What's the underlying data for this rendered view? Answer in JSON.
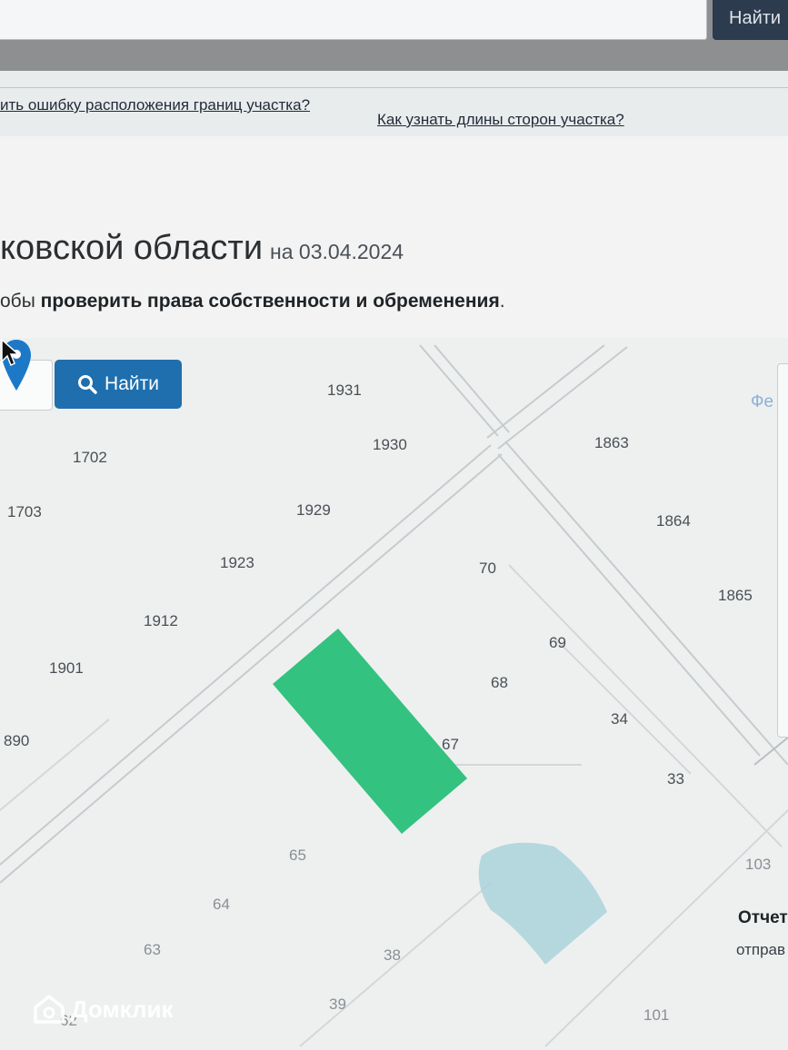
{
  "header": {
    "search_button_label": "Найти"
  },
  "help_links": [
    "ить ошибку расположения границ участка?",
    "Как узнать длины сторон участка?"
  ],
  "page": {
    "title": "ковской области",
    "date_prefix": "на 03.04.2024",
    "subtitle_prefix": "обы ",
    "subtitle_bold": "проверить права собственности и обременения",
    "subtitle_suffix": "."
  },
  "map": {
    "search_button_label": "Найти",
    "search_icon": "search-icon",
    "plot_numbers": [
      "1931",
      "1930",
      "1863",
      "1702",
      "1703",
      "1929",
      "1864",
      "1923",
      "70",
      "1865",
      "1912",
      "69",
      "1901",
      "68",
      "34",
      "890",
      "67",
      "33",
      "65",
      "103",
      "64",
      "63",
      "38",
      "39",
      "101",
      "62"
    ],
    "accent_plot_color": "#33c27f",
    "water_color": "#a9d3da",
    "pin_icon": "map-pin-icon",
    "cursor_icon": "mouse-cursor-icon"
  },
  "side_panel": {
    "text": "Фе"
  },
  "report": {
    "title": "Отчет",
    "text": "отправ"
  },
  "watermark": {
    "text": "Домклик",
    "icon": "domclick-logo-icon"
  }
}
